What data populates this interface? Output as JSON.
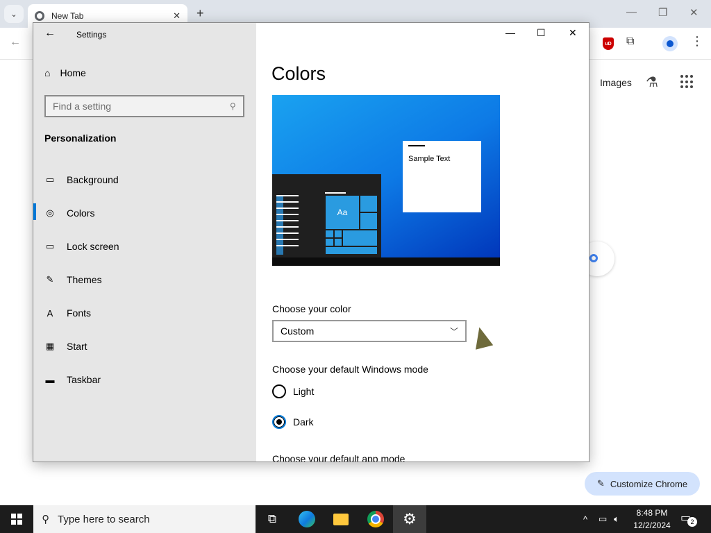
{
  "browser": {
    "tab_search_glyph": "⌄",
    "tab_title": "New Tab",
    "tab_close_glyph": "✕",
    "new_tab_glyph": "+",
    "window_min_glyph": "—",
    "window_restore_glyph": "❐",
    "window_close_glyph": "✕",
    "back_glyph": "←",
    "ublock_label": "uD",
    "images_link": "Images",
    "customize_label": "Customize Chrome",
    "customize_icon_glyph": "✎"
  },
  "settings": {
    "window_title": "Settings",
    "back_glyph": "←",
    "minimize_glyph": "—",
    "maximize_glyph": "☐",
    "close_glyph": "✕",
    "home_label": "Home",
    "search_placeholder": "Find a setting",
    "section_title": "Personalization",
    "nav_items": [
      {
        "label": "Background",
        "icon": "picture-icon"
      },
      {
        "label": "Colors",
        "icon": "palette-icon"
      },
      {
        "label": "Lock screen",
        "icon": "lock-screen-icon"
      },
      {
        "label": "Themes",
        "icon": "themes-icon"
      },
      {
        "label": "Fonts",
        "icon": "fonts-icon"
      },
      {
        "label": "Start",
        "icon": "start-icon"
      },
      {
        "label": "Taskbar",
        "icon": "taskbar-icon"
      }
    ],
    "selected_nav": "Colors",
    "page_title": "Colors",
    "preview_sample_text": "Sample Text",
    "preview_tile_text": "Aa",
    "choose_color_label": "Choose your color",
    "choose_color_value": "Custom",
    "windows_mode_label": "Choose your default Windows mode",
    "mode_light": "Light",
    "mode_dark": "Dark",
    "selected_mode": "Dark",
    "app_mode_label": "Choose your default app mode"
  },
  "taskbar": {
    "search_placeholder": "Type here to search",
    "time": "8:48 PM",
    "date": "12/2/2024",
    "notification_count": "2",
    "tray_chevron": "^"
  },
  "colors": {
    "accent": "#0078d7",
    "side_bg": "#e6e6e6",
    "taskbar_bg": "#1c1c1c"
  }
}
